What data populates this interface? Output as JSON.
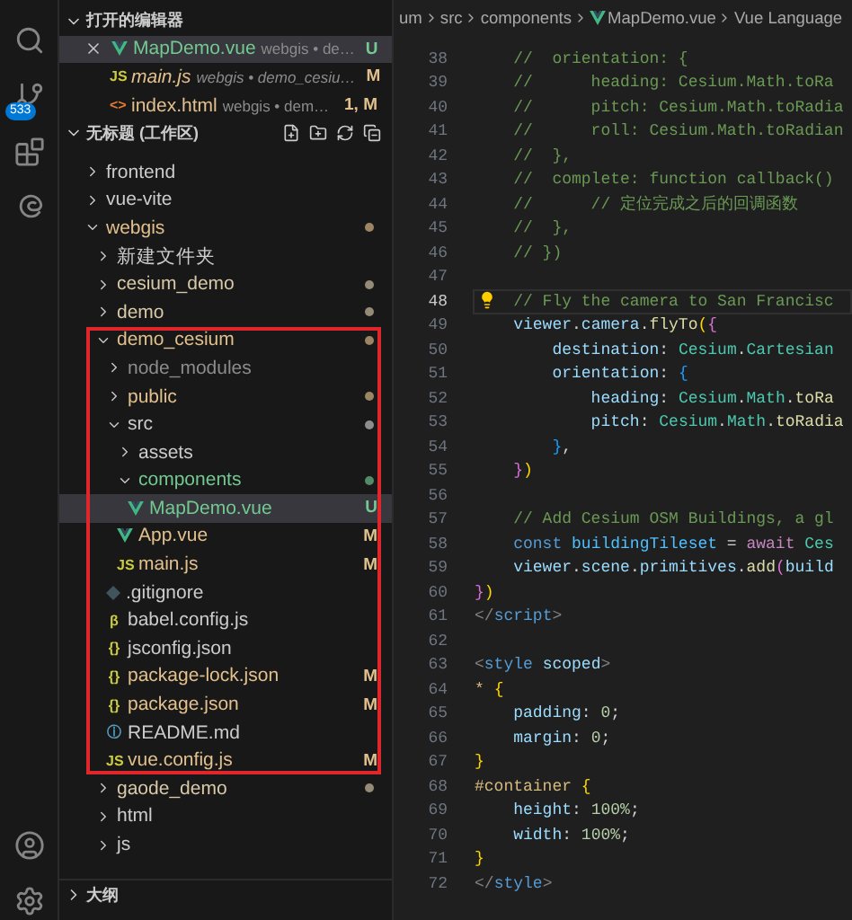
{
  "activity_bar": {
    "source_control_badge": "533"
  },
  "open_editors": {
    "title": "打开的编辑器",
    "items": [
      {
        "name": "MapDemo.vue",
        "detail": "webgis • de…",
        "badge": "U",
        "kind": "vue",
        "color": "#73c991",
        "preview": false,
        "selected": true
      },
      {
        "name": "main.js",
        "detail": "webgis • demo_cesiu…",
        "badge": "M",
        "kind": "js",
        "glyph": "JS",
        "color": "#e2c08d",
        "preview": true,
        "selected": false
      },
      {
        "name": "index.html",
        "detail": "webgis • dem…",
        "badge": "1, M",
        "kind": "html",
        "glyph": "<>",
        "color": "#e2c08d",
        "preview": false,
        "selected": false
      }
    ]
  },
  "workspace": {
    "title": "无标题 (工作区)",
    "tree": [
      {
        "name": "frontend",
        "kind": "folder",
        "expanded": false,
        "color": "#cccccc",
        "selected": false
      },
      {
        "name": "vue-vite",
        "kind": "folder",
        "expanded": false,
        "color": "#cccccc",
        "selected": false
      },
      {
        "name": "webgis",
        "kind": "folder",
        "expanded": true,
        "color": "#e2c08d",
        "dot": true,
        "selected": false,
        "children": [
          {
            "name": "新建文件夹",
            "kind": "folder",
            "expanded": false,
            "color": "#cccccc",
            "selected": false
          },
          {
            "name": "cesium_demo",
            "kind": "folder",
            "expanded": false,
            "color": "#d8c9a8",
            "dot": true,
            "selected": false
          },
          {
            "name": "demo",
            "kind": "folder",
            "expanded": false,
            "color": "#d8c9a8",
            "dot": true,
            "selected": false
          },
          {
            "name": "demo_cesium",
            "kind": "folder",
            "expanded": true,
            "color": "#e2c08d",
            "dot": true,
            "highlighted": true,
            "selected": false,
            "children": [
              {
                "name": "node_modules",
                "kind": "folder",
                "expanded": false,
                "color": "#8c8c8c",
                "selected": false
              },
              {
                "name": "public",
                "kind": "folder",
                "expanded": false,
                "color": "#e2c08d",
                "dot": true,
                "selected": false
              },
              {
                "name": "src",
                "kind": "folder",
                "expanded": true,
                "color": "#cccccc",
                "dot": true,
                "selected": false,
                "children": [
                  {
                    "name": "assets",
                    "kind": "folder",
                    "expanded": false,
                    "color": "#cccccc",
                    "selected": false
                  },
                  {
                    "name": "components",
                    "kind": "folder",
                    "expanded": true,
                    "color": "#73c991",
                    "dot": true,
                    "selected": false,
                    "children": [
                      {
                        "name": "MapDemo.vue",
                        "kind": "vue",
                        "color": "#73c991",
                        "badge": "U",
                        "selected": true
                      }
                    ]
                  },
                  {
                    "name": "App.vue",
                    "kind": "vue",
                    "color": "#e2c08d",
                    "badge": "M",
                    "selected": false
                  },
                  {
                    "name": "main.js",
                    "kind": "js",
                    "glyph": "JS",
                    "color": "#e2c08d",
                    "badge": "M",
                    "selected": false
                  }
                ]
              },
              {
                "name": ".gitignore",
                "kind": "git",
                "color": "#cccccc",
                "selected": false
              },
              {
                "name": "babel.config.js",
                "kind": "babel",
                "glyph": "β",
                "color": "#cccccc",
                "selected": false
              },
              {
                "name": "jsconfig.json",
                "kind": "json",
                "glyph": "{}",
                "color": "#cccccc",
                "selected": false
              },
              {
                "name": "package-lock.json",
                "kind": "json",
                "glyph": "{}",
                "color": "#e2c08d",
                "badge": "M",
                "selected": false
              },
              {
                "name": "package.json",
                "kind": "json",
                "glyph": "{}",
                "color": "#e2c08d",
                "badge": "M",
                "selected": false
              },
              {
                "name": "README.md",
                "kind": "info",
                "glyph": "ⓘ",
                "color": "#cccccc",
                "selected": false
              },
              {
                "name": "vue.config.js",
                "kind": "js",
                "glyph": "JS",
                "color": "#e2c08d",
                "badge": "M",
                "selected": false
              }
            ]
          },
          {
            "name": "gaode_demo",
            "kind": "folder",
            "expanded": false,
            "color": "#d8c9a8",
            "dot": true,
            "selected": false
          },
          {
            "name": "html",
            "kind": "folder",
            "expanded": false,
            "color": "#cccccc",
            "selected": false
          },
          {
            "name": "js",
            "kind": "folder",
            "expanded": false,
            "color": "#cccccc",
            "selected": false
          }
        ]
      }
    ]
  },
  "outline": {
    "title": "大纲"
  },
  "breadcrumb": [
    {
      "label": "um",
      "kind": "folder"
    },
    {
      "label": "src",
      "kind": "folder"
    },
    {
      "label": "components",
      "kind": "folder"
    },
    {
      "label": "MapDemo.vue",
      "kind": "vue"
    },
    {
      "label": "Vue Language",
      "kind": "symbol"
    }
  ],
  "code_lines": [
    {
      "number": "38",
      "tokens": [
        {
          "kind": "comment",
          "text": "    //  orientation: {"
        }
      ]
    },
    {
      "number": "39",
      "tokens": [
        {
          "kind": "comment",
          "text": "    //      heading: Cesium.Math.toRa"
        }
      ]
    },
    {
      "number": "40",
      "tokens": [
        {
          "kind": "comment",
          "text": "    //      pitch: Cesium.Math.toRadia"
        }
      ]
    },
    {
      "number": "41",
      "tokens": [
        {
          "kind": "comment",
          "text": "    //      roll: Cesium.Math.toRadian"
        }
      ]
    },
    {
      "number": "42",
      "tokens": [
        {
          "kind": "comment",
          "text": "    //  },"
        }
      ]
    },
    {
      "number": "43",
      "tokens": [
        {
          "kind": "comment",
          "text": "    //  complete: function callback()"
        }
      ]
    },
    {
      "number": "44",
      "tokens": [
        {
          "kind": "comment",
          "text": "    //      // 定位完成之后的回调函数"
        }
      ]
    },
    {
      "number": "45",
      "tokens": [
        {
          "kind": "comment",
          "text": "    //  },"
        }
      ]
    },
    {
      "number": "46",
      "tokens": [
        {
          "kind": "comment",
          "text": "    // })"
        }
      ]
    },
    {
      "number": "47",
      "current": false
    },
    {
      "number": "48",
      "current": true,
      "lightbulb": true,
      "tokens": [
        {
          "kind": "comment",
          "text": "    // Fly the camera to San Francisc"
        }
      ]
    },
    {
      "number": "49",
      "tokens": [
        {
          "kind": "var",
          "text": "    viewer"
        },
        {
          "kind": "punct",
          "text": "."
        },
        {
          "kind": "var",
          "text": "camera"
        },
        {
          "kind": "punct",
          "text": "."
        },
        {
          "kind": "func",
          "text": "flyTo"
        },
        {
          "kind": "b1",
          "text": "("
        },
        {
          "kind": "b2",
          "text": "{"
        }
      ]
    },
    {
      "number": "50",
      "tokens": [
        {
          "kind": "var",
          "text": "        destination"
        },
        {
          "kind": "punct",
          "text": ": "
        },
        {
          "kind": "class",
          "text": "Cesium"
        },
        {
          "kind": "punct",
          "text": "."
        },
        {
          "kind": "class",
          "text": "Cartesian"
        }
      ]
    },
    {
      "number": "51",
      "tokens": [
        {
          "kind": "var",
          "text": "        orientation"
        },
        {
          "kind": "punct",
          "text": ": "
        },
        {
          "kind": "b3",
          "text": "{"
        }
      ]
    },
    {
      "number": "52",
      "tokens": [
        {
          "kind": "var",
          "text": "            heading"
        },
        {
          "kind": "punct",
          "text": ": "
        },
        {
          "kind": "class",
          "text": "Cesium"
        },
        {
          "kind": "punct",
          "text": "."
        },
        {
          "kind": "class",
          "text": "Math"
        },
        {
          "kind": "punct",
          "text": "."
        },
        {
          "kind": "func",
          "text": "toRa"
        }
      ]
    },
    {
      "number": "53",
      "tokens": [
        {
          "kind": "var",
          "text": "            pitch"
        },
        {
          "kind": "punct",
          "text": ": "
        },
        {
          "kind": "class",
          "text": "Cesium"
        },
        {
          "kind": "punct",
          "text": "."
        },
        {
          "kind": "class",
          "text": "Math"
        },
        {
          "kind": "punct",
          "text": "."
        },
        {
          "kind": "func",
          "text": "toRadia"
        }
      ]
    },
    {
      "number": "54",
      "tokens": [
        {
          "kind": "b3",
          "text": "        }"
        },
        {
          "kind": "punct",
          "text": ","
        }
      ]
    },
    {
      "number": "55",
      "tokens": [
        {
          "kind": "b2",
          "text": "    }"
        },
        {
          "kind": "b1",
          "text": ")"
        }
      ]
    },
    {
      "number": "56"
    },
    {
      "number": "57",
      "tokens": [
        {
          "kind": "comment",
          "text": "    // Add Cesium OSM Buildings, a gl"
        }
      ]
    },
    {
      "number": "58",
      "tokens": [
        {
          "kind": "keyword",
          "text": "    const "
        },
        {
          "kind": "const",
          "text": "buildingTileset"
        },
        {
          "kind": "punct",
          "text": " = "
        },
        {
          "kind": "control",
          "text": "await "
        },
        {
          "kind": "class",
          "text": "Ces"
        }
      ]
    },
    {
      "number": "59",
      "tokens": [
        {
          "kind": "var",
          "text": "    viewer"
        },
        {
          "kind": "punct",
          "text": "."
        },
        {
          "kind": "var",
          "text": "scene"
        },
        {
          "kind": "punct",
          "text": "."
        },
        {
          "kind": "var",
          "text": "primitives"
        },
        {
          "kind": "punct",
          "text": "."
        },
        {
          "kind": "func",
          "text": "add"
        },
        {
          "kind": "b2",
          "text": "("
        },
        {
          "kind": "var",
          "text": "build"
        }
      ]
    },
    {
      "number": "60",
      "tokens": [
        {
          "kind": "b2",
          "text": "}"
        },
        {
          "kind": "b1",
          "text": ")"
        }
      ]
    },
    {
      "number": "61",
      "tokens": [
        {
          "kind": "tagpunct",
          "text": "</"
        },
        {
          "kind": "tag",
          "text": "script"
        },
        {
          "kind": "tagpunct",
          "text": ">"
        }
      ]
    },
    {
      "number": "62"
    },
    {
      "number": "63",
      "tokens": [
        {
          "kind": "tagpunct",
          "text": "<"
        },
        {
          "kind": "tag",
          "text": "style "
        },
        {
          "kind": "var",
          "text": "scoped"
        },
        {
          "kind": "tagpunct",
          "text": ">"
        }
      ]
    },
    {
      "number": "64",
      "tokens": [
        {
          "kind": "selector",
          "text": "* "
        },
        {
          "kind": "b1",
          "text": "{"
        }
      ]
    },
    {
      "number": "65",
      "tokens": [
        {
          "kind": "var",
          "text": "    padding"
        },
        {
          "kind": "punct",
          "text": ": "
        },
        {
          "kind": "number",
          "text": "0"
        },
        {
          "kind": "punct",
          "text": ";"
        }
      ]
    },
    {
      "number": "66",
      "tokens": [
        {
          "kind": "var",
          "text": "    margin"
        },
        {
          "kind": "punct",
          "text": ": "
        },
        {
          "kind": "number",
          "text": "0"
        },
        {
          "kind": "punct",
          "text": ";"
        }
      ]
    },
    {
      "number": "67",
      "tokens": [
        {
          "kind": "b1",
          "text": "}"
        }
      ]
    },
    {
      "number": "68",
      "tokens": [
        {
          "kind": "selector",
          "text": "#container "
        },
        {
          "kind": "b1",
          "text": "{"
        }
      ]
    },
    {
      "number": "69",
      "tokens": [
        {
          "kind": "var",
          "text": "    height"
        },
        {
          "kind": "punct",
          "text": ": "
        },
        {
          "kind": "number",
          "text": "100%"
        },
        {
          "kind": "punct",
          "text": ";"
        }
      ]
    },
    {
      "number": "70",
      "tokens": [
        {
          "kind": "var",
          "text": "    width"
        },
        {
          "kind": "punct",
          "text": ": "
        },
        {
          "kind": "number",
          "text": "100%"
        },
        {
          "kind": "punct",
          "text": ";"
        }
      ]
    },
    {
      "number": "71",
      "tokens": [
        {
          "kind": "b1",
          "text": "}"
        }
      ]
    },
    {
      "number": "72",
      "tokens": [
        {
          "kind": "tagpunct",
          "text": "</"
        },
        {
          "kind": "tag",
          "text": "style"
        },
        {
          "kind": "tagpunct",
          "text": ">"
        }
      ]
    }
  ]
}
